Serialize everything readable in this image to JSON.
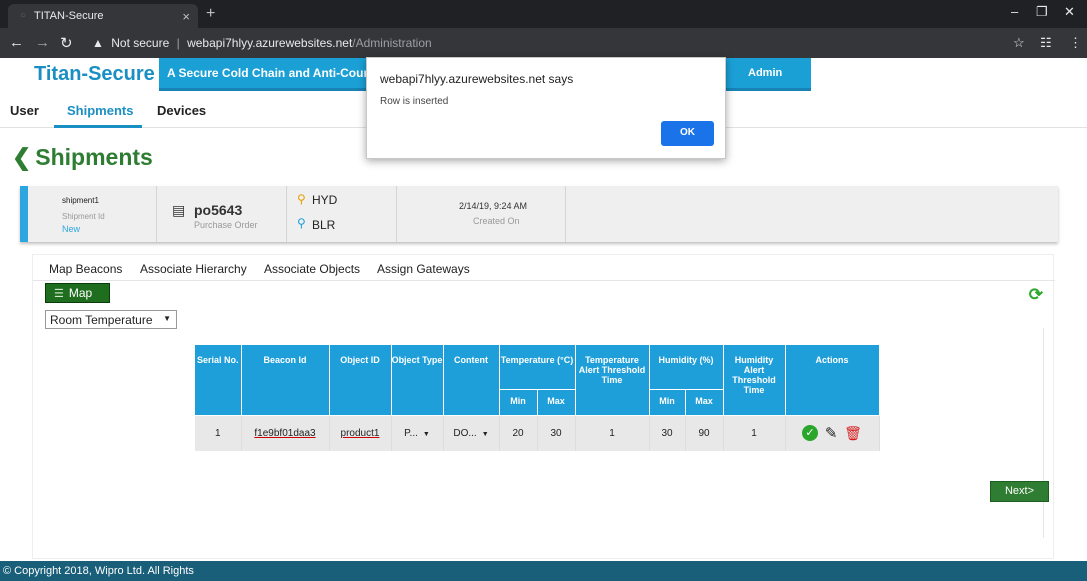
{
  "browser": {
    "tab_title": "TITAN-Secure",
    "new_tab": "+",
    "security": "Not secure",
    "url_host": "webapi7hlyy.azurewebsites.net",
    "url_path": "/Administration"
  },
  "header": {
    "brand": "Titan-Secure",
    "tagline": "A Secure Cold Chain and Anti-Counter",
    "admin": "Admin"
  },
  "nav": {
    "tabs": [
      "User",
      "Shipments",
      "Devices"
    ]
  },
  "page": {
    "title": "Shipments"
  },
  "shipment": {
    "id": "shipment1",
    "id_label": "Shipment Id",
    "status": "New",
    "po": "po5643",
    "po_label": "Purchase Order",
    "origin": "HYD",
    "destination": "BLR",
    "created": "2/14/19, 9:24 AM",
    "created_label": "Created On"
  },
  "subtabs": [
    "Map Beacons",
    "Associate Hierarchy",
    "Associate Objects",
    "Assign Gateways"
  ],
  "map_button": "Map",
  "select": {
    "value": "Room Temperature"
  },
  "table": {
    "headers": {
      "serial": "Serial No.",
      "beacon": "Beacon Id",
      "object_id": "Object ID",
      "object_type": "Object Type",
      "content": "Content",
      "temperature": "Temperature (°C)",
      "temp_alert": "Temperature Alert Threshold Time",
      "humidity": "Humidity (%)",
      "hum_alert": "Humidity Alert Threshold Time",
      "actions": "Actions",
      "min": "Min",
      "max": "Max"
    },
    "row": {
      "serial": "1",
      "beacon": "f1e9bf01daa3",
      "object_id": "product1",
      "object_type": "P...",
      "content": "DO...",
      "temp_min": "20",
      "temp_max": "30",
      "temp_alert": "1",
      "hum_min": "30",
      "hum_max": "90",
      "hum_alert": "1"
    }
  },
  "next_button": "Next>",
  "footer": "© Copyright 2018, Wipro Ltd. All Rights",
  "dialog": {
    "title": "webapi7hlyy.azurewebsites.net says",
    "message": "Row is inserted",
    "ok": "OK"
  }
}
